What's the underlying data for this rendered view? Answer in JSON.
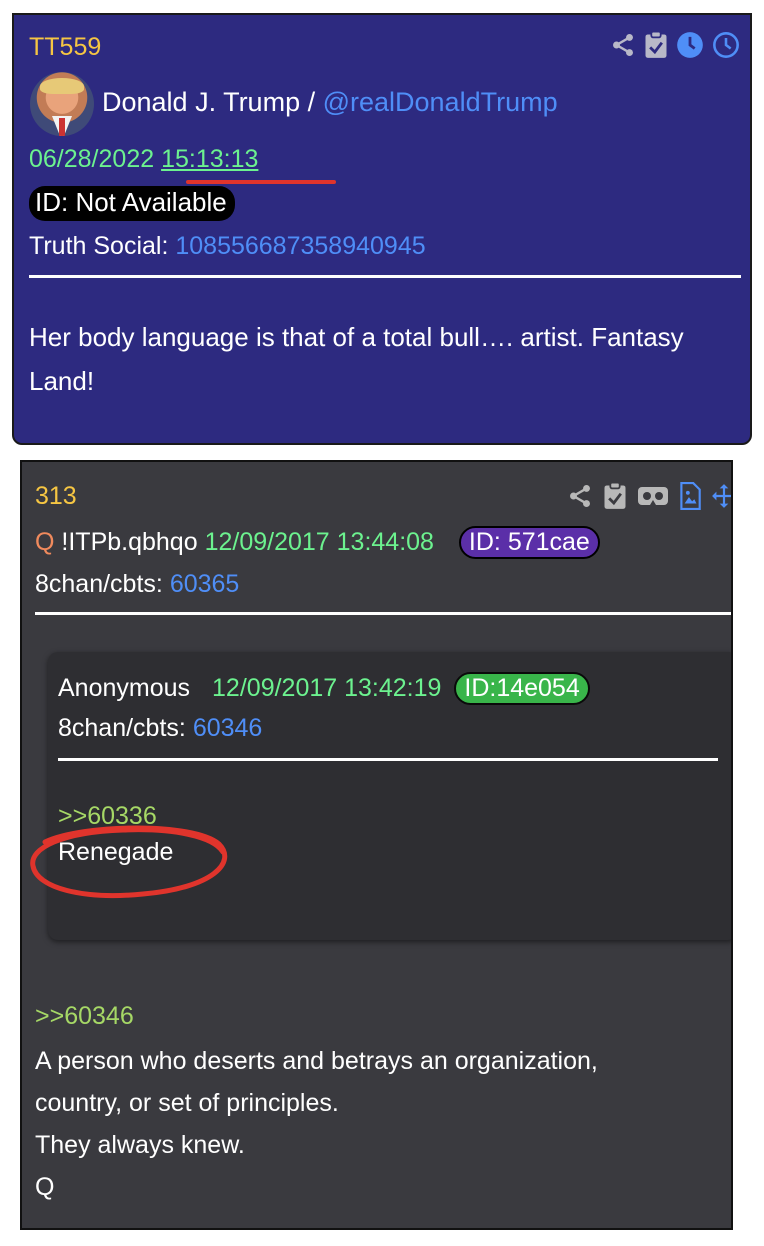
{
  "post1": {
    "number": "TT559",
    "author": "Donald J. Trump / ",
    "handle": "@realDonaldTrump",
    "date": "06/28/2022 ",
    "time": "15:13:13",
    "id_badge": "ID: Not Available",
    "source_label": "Truth Social: ",
    "source_id": "108556687358940945",
    "body": "Her body language is that of a total bull…. artist. Fantasy Land!",
    "icons": [
      "share-icon",
      "clipboard-check-icon",
      "clock-filled-icon",
      "clock-outline-icon"
    ],
    "colors": {
      "background": "#2d2a80",
      "number": "#f6c643",
      "date": "#6cf28f",
      "link": "#4f8ef7",
      "underline": "#e0342c"
    }
  },
  "post2": {
    "number": "313",
    "q_letter": "Q",
    "tripcode": "!ITPb.qbhqo",
    "date": "12/09/2017 13:44:08",
    "id_badge": "ID: 571cae",
    "source_label": "8chan/cbts: ",
    "source_id": "60365",
    "icons": [
      "share-icon",
      "clipboard-check-icon",
      "vr-goggles-icon",
      "image-file-icon",
      "move-arrows-icon"
    ],
    "quoted": {
      "author": "Anonymous",
      "date": "12/09/2017 13:42:19",
      "id_badge": "ID:14e054",
      "source_label": "8chan/cbts: ",
      "source_id": "60346",
      "reply_ref": ">>60336",
      "text": "Renegade"
    },
    "reply_ref": ">>60346",
    "body_lines": [
      "A person who deserts and betrays an organization,",
      "country, or set of principles.",
      "They always knew.",
      "Q"
    ],
    "colors": {
      "background": "#3a3a3f",
      "inner_background": "#2e2e32",
      "id_badge": "#5b2fa8",
      "quoted_id_badge": "#39b54a",
      "reply_ref": "#a6d866",
      "circle": "#e0342c"
    }
  }
}
